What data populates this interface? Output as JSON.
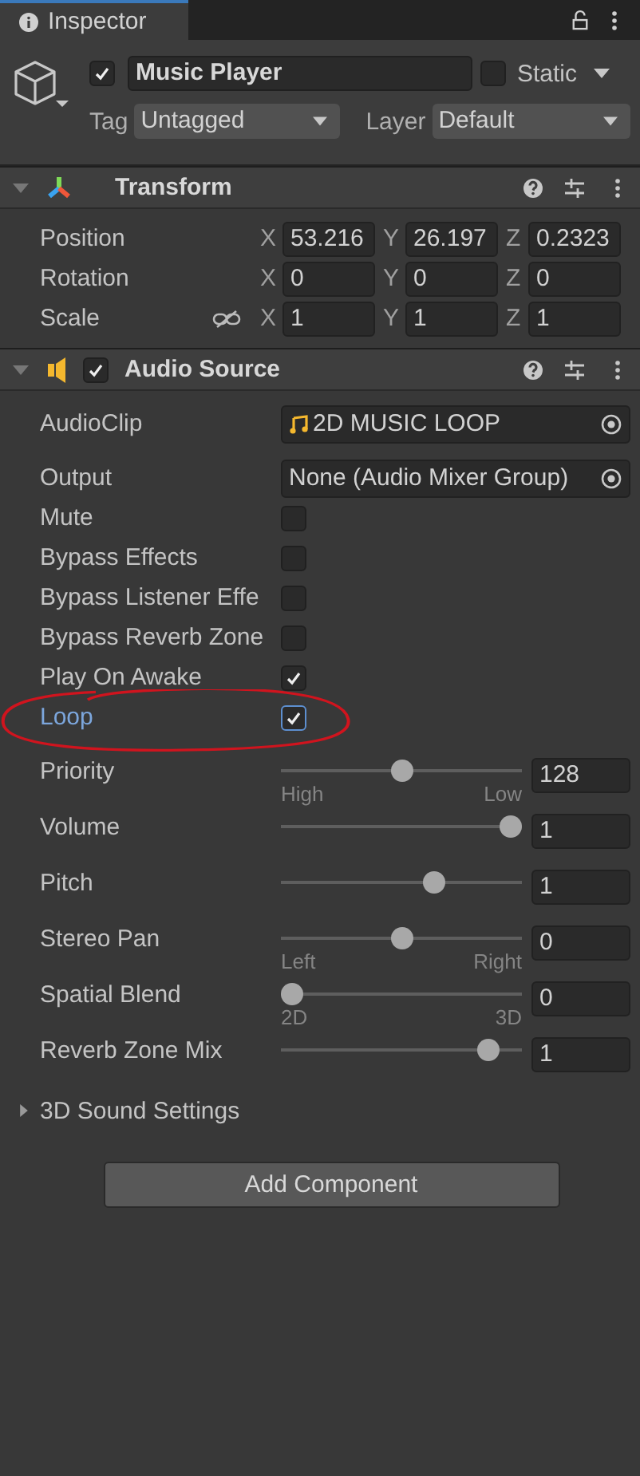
{
  "tab": {
    "label": "Inspector"
  },
  "object": {
    "active": true,
    "name": "Music Player",
    "static": false,
    "static_label": "Static",
    "tag_label": "Tag",
    "tag": "Untagged",
    "layer_label": "Layer",
    "layer": "Default"
  },
  "transform": {
    "title": "Transform",
    "expanded": true,
    "rows": [
      {
        "label": "Position",
        "fields": [
          {
            "axis": "X",
            "value": "53.216"
          },
          {
            "axis": "Y",
            "value": "26.197"
          },
          {
            "axis": "Z",
            "value": "0.2323"
          }
        ]
      },
      {
        "label": "Rotation",
        "fields": [
          {
            "axis": "X",
            "value": "0"
          },
          {
            "axis": "Y",
            "value": "0"
          },
          {
            "axis": "Z",
            "value": "0"
          }
        ]
      },
      {
        "label": "Scale",
        "constrained": false,
        "fields": [
          {
            "axis": "X",
            "value": "1"
          },
          {
            "axis": "Y",
            "value": "1"
          },
          {
            "axis": "Z",
            "value": "1"
          }
        ]
      }
    ]
  },
  "audio_source": {
    "title": "Audio Source",
    "enabled": true,
    "expanded": true,
    "properties": [
      {
        "kind": "object",
        "label": "AudioClip",
        "value": "2D MUSIC LOOP",
        "asset_icon": true
      },
      {
        "kind": "object",
        "label": "Output",
        "value": "None (Audio Mixer Group)",
        "asset_icon": false
      },
      {
        "kind": "toggle",
        "label": "Mute",
        "checked": false,
        "focused": false
      },
      {
        "kind": "toggle",
        "label": "Bypass Effects",
        "checked": false,
        "focused": false
      },
      {
        "kind": "toggle",
        "label": "Bypass Listener Effe",
        "checked": false,
        "focused": false
      },
      {
        "kind": "toggle",
        "label": "Bypass Reverb Zone",
        "checked": false,
        "focused": false
      },
      {
        "kind": "toggle",
        "label": "Play On Awake",
        "checked": true,
        "focused": false
      },
      {
        "kind": "toggle",
        "label": "Loop",
        "checked": true,
        "focused": true
      },
      {
        "kind": "slider",
        "label": "Priority",
        "level": 0.5,
        "value": "128",
        "min_label": "High",
        "max_label": "Low"
      },
      {
        "kind": "slider",
        "label": "Volume",
        "level": 1,
        "value": "1"
      },
      {
        "kind": "slider",
        "label": "Pitch",
        "level": 0.65,
        "value": "1"
      },
      {
        "kind": "slider",
        "label": "Stereo Pan",
        "level": 0.5,
        "value": "0",
        "min_label": "Left",
        "max_label": "Right"
      },
      {
        "kind": "slider",
        "label": "Spatial Blend",
        "level": 0,
        "value": "0",
        "min_label": "2D",
        "max_label": "3D"
      },
      {
        "kind": "slider",
        "label": "Reverb Zone Mix",
        "level": 0.9,
        "value": "1"
      }
    ],
    "foldout": {
      "label": "3D Sound Settings",
      "expanded": false
    }
  },
  "add_component": "Add Component"
}
